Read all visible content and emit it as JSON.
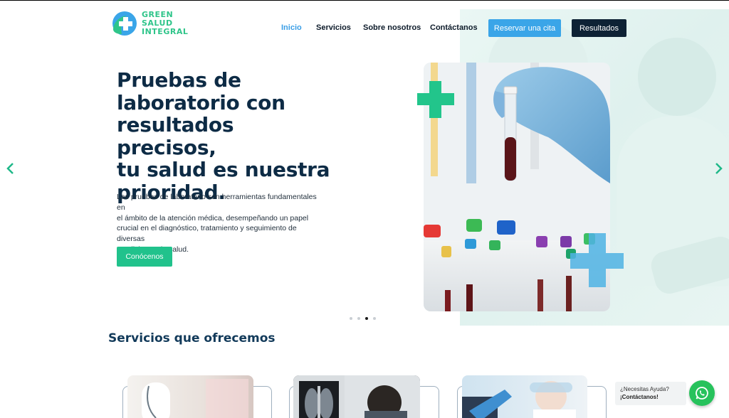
{
  "brand": {
    "line1": "GREEN",
    "line2": "SALUD",
    "line3": "INTEGRAL",
    "colors": {
      "green": "#2fc58a",
      "blue": "#3aa5e8",
      "navy": "#0e2235"
    }
  },
  "nav": {
    "items": [
      {
        "label": "Inicio",
        "active": true
      },
      {
        "label": "Servicios",
        "active": false
      },
      {
        "label": "Sobre nosotros",
        "active": false
      },
      {
        "label": "Contáctanos",
        "active": false
      }
    ],
    "reservar_label": "Reservar una cita",
    "resultados_label": "Resultados"
  },
  "hero": {
    "title_lines": [
      "Pruebas de",
      "laboratorio con",
      "resultados precisos,",
      "tu salud es nuestra",
      "prioridad."
    ],
    "desc_lines": [
      "Las pruebas de laboratorio son herramientas fundamentales en",
      "el ámbito de la atención médica, desempeñando un papel",
      "crucial en el diagnóstico, tratamiento y seguimiento de diversas",
      "condiciones de salud."
    ],
    "cta_label": "Conócenos",
    "slide_count": 4,
    "active_slide": 3
  },
  "services": {
    "title": "Servicios que ofrecemos"
  },
  "help": {
    "line1": "¿Necesitas Ayuda?",
    "line2": "¡Contáctanos!"
  },
  "icons": {
    "logo": "green-cross-logo-icon",
    "prev": "chevron-left-icon",
    "next": "chevron-right-icon",
    "chat": "whatsapp-icon"
  }
}
